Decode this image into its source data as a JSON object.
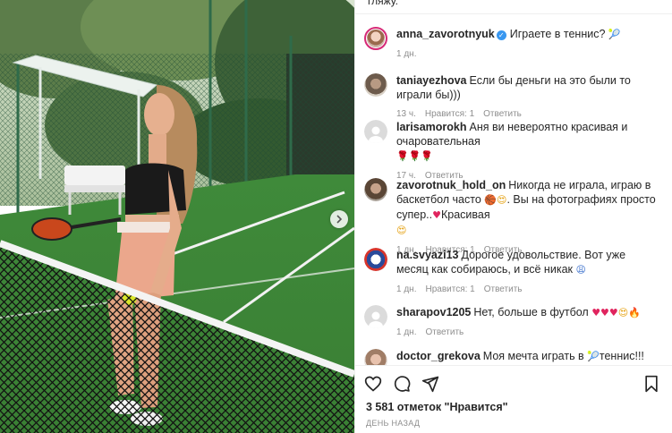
{
  "post": {
    "top_cut_text": "гляжу.",
    "caption": {
      "username": "anna_zavorotnyuk",
      "text": "Играете в теннис?",
      "time": "1 дн."
    },
    "comments": [
      {
        "username": "taniayezhova",
        "text": "Если бы деньги на это были то играли бы)))",
        "time": "13 ч.",
        "likes": "Нравится: 1",
        "reply": "Ответить"
      },
      {
        "username": "larisamorokh",
        "text": "Аня ви невероятно красивая и очаровательная",
        "time": "17 ч.",
        "reply": "Ответить"
      },
      {
        "username": "zavorotnuk_hold_on",
        "text_a": "Никогда не играла, играю в баскетбол часто",
        "text_b": ". Вы на фотографиях просто супер..",
        "text_c": "Красивая",
        "time": "1 дн.",
        "likes": "Нравится: 1",
        "reply": "Ответить"
      },
      {
        "username": "na.svyazi13",
        "text": "Дорогое удовольствие. Вот уже месяц как собираюсь, и всё никак",
        "time": "1 дн.",
        "likes": "Нравится: 1",
        "reply": "Ответить"
      },
      {
        "username": "sharapov1205",
        "text": "Нет, больше в футбол",
        "time": "1 дн.",
        "reply": "Ответить"
      },
      {
        "username": "doctor_grekova",
        "text_a": "Моя мечта играть в",
        "text_b": "теннис!!! Регулярно)"
      }
    ],
    "likes_text": "3 581 отметок \"Нравится\"",
    "date_text": "День назад"
  },
  "icons": {
    "like": "heart-icon",
    "comment": "comment-icon",
    "share": "share-icon",
    "save": "bookmark-icon",
    "verified": "verified-badge",
    "next": "chevron-right-icon"
  },
  "colors": {
    "verified": "#3897f0",
    "meta_text": "#8e8e8e",
    "heart_emoji": "#e0245e"
  }
}
